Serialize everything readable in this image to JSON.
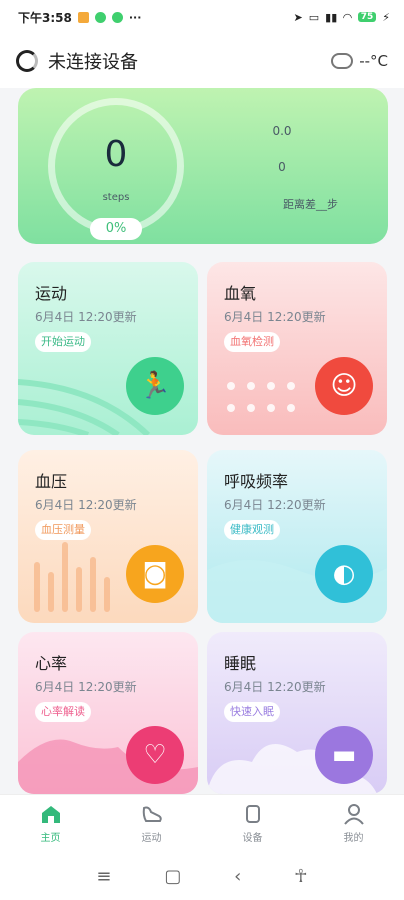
{
  "status_bar": {
    "time": "下午3:58",
    "battery": "75",
    "signal_icons": [
      "alarm-icon",
      "location-icon",
      "vibrate-icon",
      "signal-icon",
      "wifi-icon",
      "battery-icon"
    ]
  },
  "header": {
    "title": "未连接设备",
    "temperature": "--°C"
  },
  "steps": {
    "value": "0",
    "unit": "steps",
    "percent": "0%",
    "stat_1": "0.0",
    "stat_2": "0",
    "stat_3": "距离差__步"
  },
  "tiles": {
    "sport": {
      "title": "运动",
      "date": "6月4日 12:20更新",
      "tag": "开始运动"
    },
    "oxygen": {
      "title": "血氧",
      "date": "6月4日 12:20更新",
      "tag": "血氧检测"
    },
    "bp": {
      "title": "血压",
      "date": "6月4日 12:20更新",
      "tag": "血压测量"
    },
    "breath": {
      "title": "呼吸频率",
      "date": "6月4日 12:20更新",
      "tag": "健康观测"
    },
    "heart": {
      "title": "心率",
      "date": "6月4日 12:20更新",
      "tag": "心率解读"
    },
    "sleep": {
      "title": "睡眠",
      "date": "6月4日 12:20更新",
      "tag": "快速入眠"
    }
  },
  "nav": [
    {
      "label": "主页",
      "icon": "home-icon",
      "active": true
    },
    {
      "label": "运动",
      "icon": "shoe-icon",
      "active": false
    },
    {
      "label": "设备",
      "icon": "watch-icon",
      "active": false
    },
    {
      "label": "我的",
      "icon": "person-icon",
      "active": false
    }
  ],
  "colors": {
    "accent": "#33b97b",
    "steps_card": "#9fe7a8",
    "sport": "#3ed08d",
    "oxygen": "#f04a3e",
    "bp": "#f7a51e",
    "breath": "#30c0d8",
    "heart": "#ec3d74",
    "sleep": "#9b77df"
  }
}
